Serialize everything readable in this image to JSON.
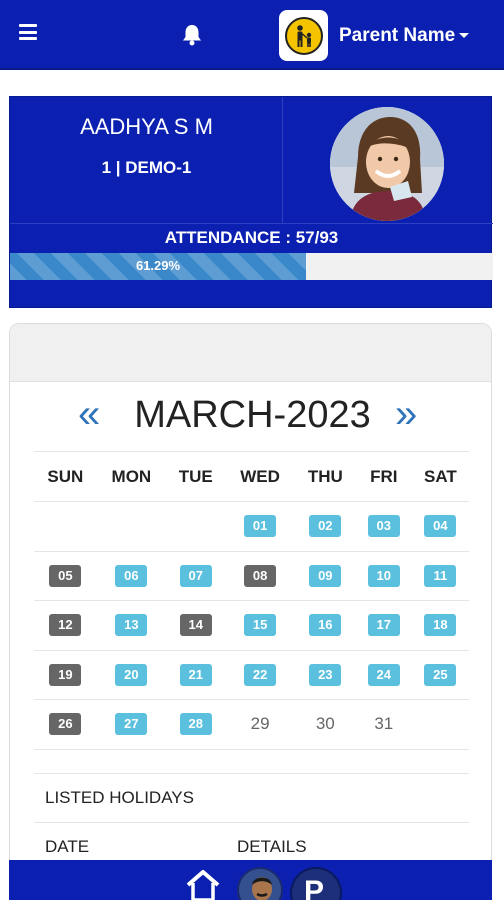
{
  "topbar": {
    "parent_name": "Parent Name"
  },
  "student": {
    "name": "AADHYA S M",
    "class_label": "1 | DEMO-1",
    "attendance_label": "ATTENDANCE : 57/93",
    "attendance_percent_label": "61.29%",
    "attendance_fraction": 0.6129
  },
  "calendar": {
    "prev_label": "«",
    "next_label": "»",
    "month_title": "MARCH-2023",
    "weekdays": [
      "SUN",
      "MON",
      "TUE",
      "WED",
      "THU",
      "FRI",
      "SAT"
    ],
    "weeks": [
      [
        null,
        null,
        null,
        {
          "d": "01",
          "s": "present"
        },
        {
          "d": "02",
          "s": "present"
        },
        {
          "d": "03",
          "s": "present"
        },
        {
          "d": "04",
          "s": "present"
        }
      ],
      [
        {
          "d": "05",
          "s": "absent"
        },
        {
          "d": "06",
          "s": "present"
        },
        {
          "d": "07",
          "s": "present"
        },
        {
          "d": "08",
          "s": "absent"
        },
        {
          "d": "09",
          "s": "present"
        },
        {
          "d": "10",
          "s": "present"
        },
        {
          "d": "11",
          "s": "present"
        }
      ],
      [
        {
          "d": "12",
          "s": "absent"
        },
        {
          "d": "13",
          "s": "present"
        },
        {
          "d": "14",
          "s": "absent"
        },
        {
          "d": "15",
          "s": "present"
        },
        {
          "d": "16",
          "s": "present"
        },
        {
          "d": "17",
          "s": "present"
        },
        {
          "d": "18",
          "s": "present"
        }
      ],
      [
        {
          "d": "19",
          "s": "absent"
        },
        {
          "d": "20",
          "s": "present"
        },
        {
          "d": "21",
          "s": "present"
        },
        {
          "d": "22",
          "s": "present"
        },
        {
          "d": "23",
          "s": "present"
        },
        {
          "d": "24",
          "s": "present"
        },
        {
          "d": "25",
          "s": "present"
        }
      ],
      [
        {
          "d": "26",
          "s": "absent"
        },
        {
          "d": "27",
          "s": "present"
        },
        {
          "d": "28",
          "s": "present"
        },
        {
          "d": "29",
          "s": "plain"
        },
        {
          "d": "30",
          "s": "plain"
        },
        {
          "d": "31",
          "s": "plain"
        },
        null
      ]
    ],
    "colors": {
      "present": "#5bc0de",
      "absent": "#666666",
      "header_blue": "#0b20b0",
      "nav_arrow": "#2f73b8"
    }
  },
  "holidays": {
    "title": "LISTED HOLIDAYS",
    "col_date": "DATE",
    "col_details": "DETAILS"
  },
  "icons": {
    "menu": "hamburger-icon",
    "notifications": "bell-icon",
    "home": "home-icon"
  }
}
